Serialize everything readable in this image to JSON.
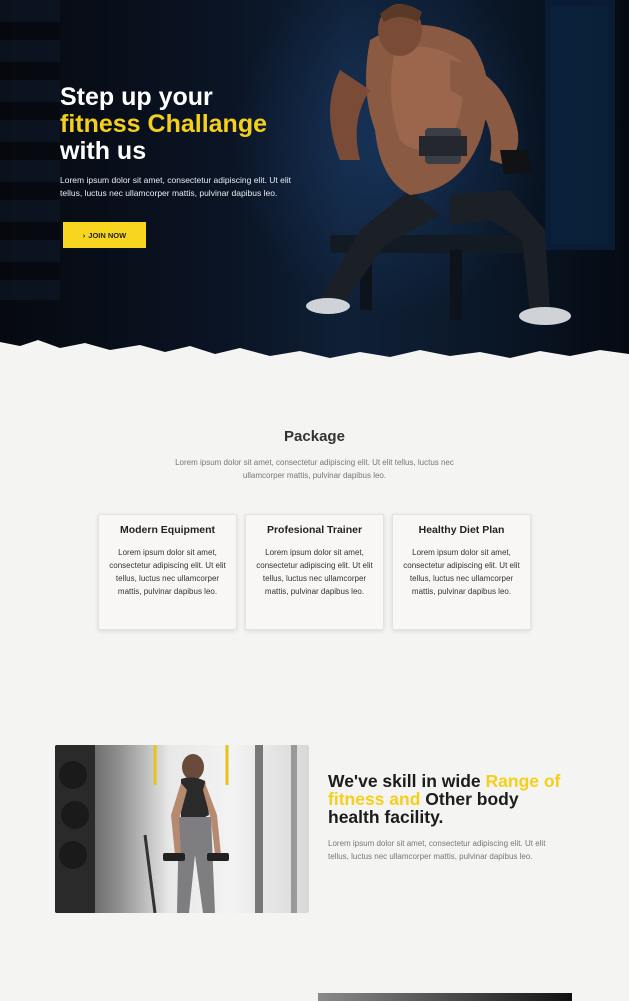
{
  "hero": {
    "title_line1": "Step up your",
    "title_line2": "fitness Challange",
    "title_line3": "with us",
    "text": "Lorem ipsum dolor sit amet, consectetur adipiscing elit. Ut elit tellus, luctus nec ullamcorper mattis, pulvinar dapibus leo.",
    "button_icon": "›",
    "button_label": "JOIN NOW",
    "accent_color": "#f5cf1c"
  },
  "package": {
    "title": "Package",
    "subtitle": "Lorem ipsum dolor sit amet, consectetur adipiscing elit. Ut elit tellus, luctus nec ullamcorper mattis, pulvinar dapibus leo.",
    "cards": [
      {
        "title": "Modern Equipment",
        "text": "Lorem ipsum dolor sit amet, consectetur adipiscing elit. Ut elit tellus, luctus nec ullamcorper mattis, pulvinar dapibus leo."
      },
      {
        "title": "Profesional Trainer",
        "text": "Lorem ipsum dolor sit amet, consectetur adipiscing elit. Ut elit tellus, luctus nec ullamcorper mattis, pulvinar dapibus leo."
      },
      {
        "title": "Healthy Diet Plan",
        "text": "Lorem ipsum dolor sit amet, consectetur adipiscing elit. Ut elit tellus, luctus nec ullamcorper mattis, pulvinar dapibus leo."
      }
    ]
  },
  "facility": {
    "title_part1": "We've skill in wide ",
    "title_highlight": "Range of fitness and",
    "title_part2": " Other body health facility.",
    "text": "Lorem ipsum dolor sit amet, consectetur adipiscing elit. Ut elit tellus, luctus nec ullamcorper mattis, pulvinar dapibus leo."
  }
}
